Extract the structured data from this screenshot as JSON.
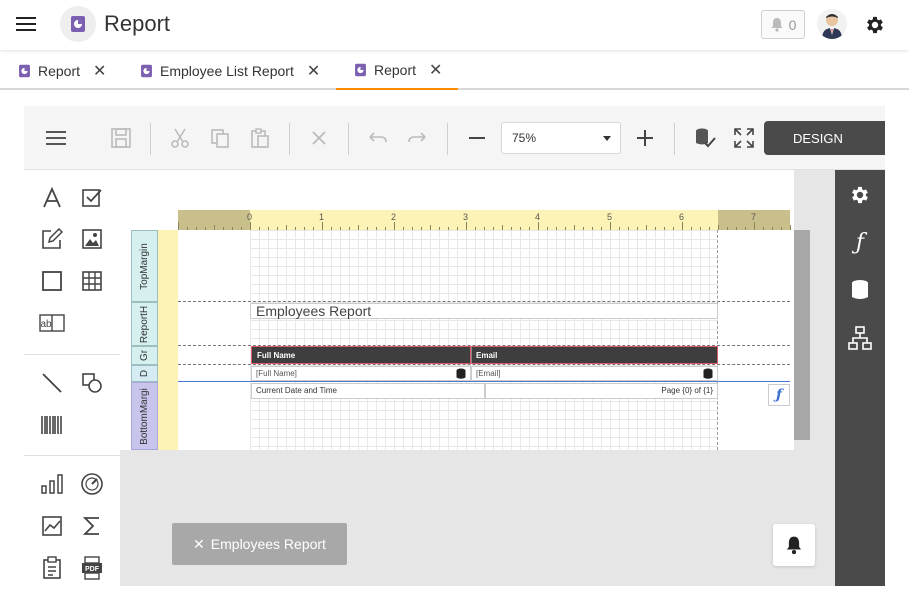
{
  "header": {
    "title": "Report",
    "notification_count": "0",
    "icons": [
      "menu-icon",
      "report-icon",
      "bell-icon",
      "avatar",
      "gear-icon"
    ]
  },
  "tabs": [
    {
      "label": "Report",
      "active": false
    },
    {
      "label": "Employee List Report",
      "active": false
    },
    {
      "label": "Report",
      "active": true
    }
  ],
  "toolbar": {
    "zoom": "75%",
    "design_label": "DESIGN",
    "icons": [
      "hamburger-icon",
      "save-icon",
      "cut-icon",
      "copy-icon",
      "paste-icon",
      "delete-icon",
      "undo-icon",
      "redo-icon",
      "zoom-out-icon",
      "zoom-in-icon",
      "validate-icon",
      "fullscreen-icon"
    ]
  },
  "toolbox": {
    "icons": [
      "label-icon",
      "checkbox-icon",
      "rich-text-icon",
      "picture-icon",
      "panel-icon",
      "table-icon",
      "character-comb-icon",
      "line-icon",
      "shape-icon",
      "barcode-icon",
      "chart-icon",
      "gauge-icon",
      "sparkline-icon",
      "summary-icon",
      "subreport-icon",
      "pdf-icon"
    ],
    "comb_text": "ab",
    "pdf_text": "PDF"
  },
  "properties_panel": {
    "icons": [
      "settings-icon",
      "expressions-icon",
      "data-source-icon",
      "report-explorer-icon"
    ],
    "fx_glyph": "ƒ"
  },
  "ruler": {
    "numbers": [
      "0",
      "1",
      "2",
      "3",
      "4",
      "5",
      "6",
      "7"
    ]
  },
  "bands": {
    "top_margin": "TopMargin",
    "report_header": "ReportH",
    "group_header": "Gr",
    "detail": "D",
    "bottom_margin": "BottomMargi"
  },
  "report": {
    "title": "Employees Report",
    "col1_header": "Full Name",
    "col2_header": "Email",
    "col1_field": "[Full Name]",
    "col2_field": "[Email]",
    "footer_left": "Current Date and Time",
    "footer_right": "Page {0} of {1}",
    "expression_glyph": "ƒ"
  },
  "close_report_label": "Employees Report",
  "colors": {
    "accent_tab": "#ff8a00",
    "dark_panel": "#4a4a4a",
    "icon_purple": "#7b5fb0",
    "band_teal": "#d6efef",
    "band_blue": "#d6ecf5",
    "band_lavender": "#c7c5ec",
    "ruler_yellow": "#fdf3b7"
  }
}
